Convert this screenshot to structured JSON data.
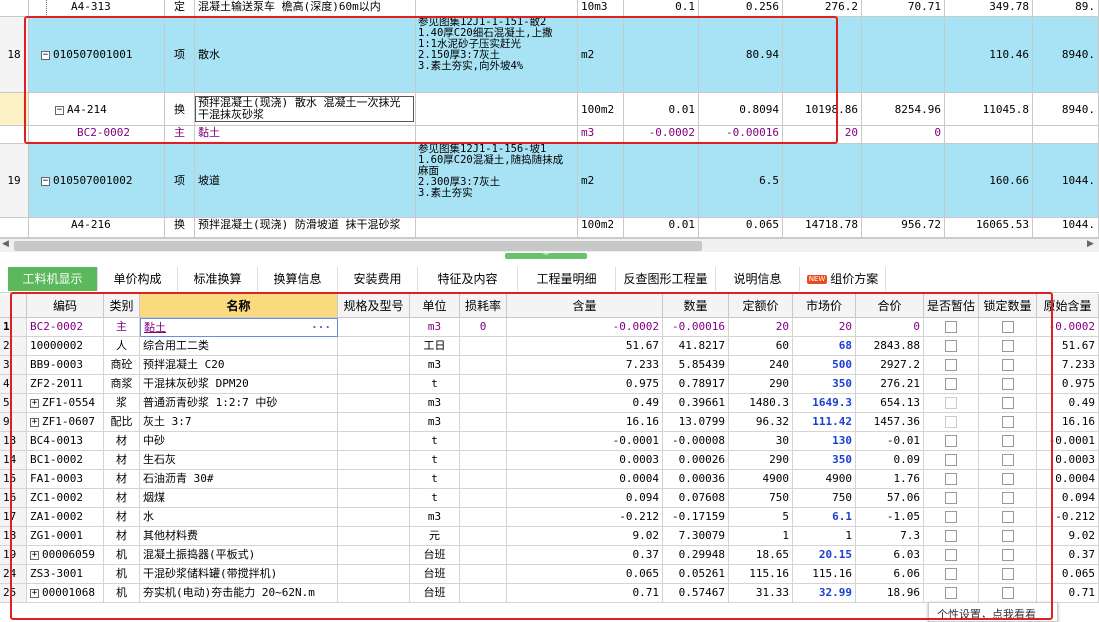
{
  "top_rows": [
    {
      "rownum": "",
      "code": "A4-313",
      "type": "定",
      "name": "混凝土输送泵车 檐高(深度)60m以内",
      "desc": "",
      "unit": "10m3",
      "c1": "0.1",
      "c2": "0.256",
      "c3": "276.2",
      "c4": "70.71",
      "c5": "349.78",
      "c6": "89."
    },
    {
      "rownum": "18",
      "code": "010507001001",
      "type": "项",
      "name": "散水",
      "desc": "参见图集12J1-1-151-散2\n1.40厚C20细石混凝土,上撒\n1:1水泥砂子压实赶光\n2.150厚3:7灰土\n3.素土夯实,向外坡4%",
      "unit": "m2",
      "c1": "",
      "c2": "80.94",
      "c3": "",
      "c4": "",
      "c5": "110.46",
      "c6": "8940."
    },
    {
      "rownum": "",
      "code": "A4-214",
      "type": "换",
      "name": "预拌混凝土(现浇) 散水 混凝土一次抹光 干混抹灰砂浆",
      "desc": "",
      "unit": "100m2",
      "c1": "0.01",
      "c2": "0.8094",
      "c3": "10198.86",
      "c4": "8254.96",
      "c5": "11045.8",
      "c6": "8940."
    },
    {
      "rownum": "",
      "code": "BC2-0002",
      "type": "主",
      "name": "黏土",
      "desc": "",
      "unit": "m3",
      "c1": "-0.0002",
      "c2": "-0.00016",
      "c3": "20",
      "c4": "0",
      "c5": "",
      "c6": ""
    },
    {
      "rownum": "19",
      "code": "010507001002",
      "type": "项",
      "name": "坡道",
      "desc": "参见图集12J1-1-156-坡1\n1.60厚C20混凝土,随捣随抹成\n麻面\n2.300厚3:7灰土\n3.素土夯实",
      "unit": "m2",
      "c1": "",
      "c2": "6.5",
      "c3": "",
      "c4": "",
      "c5": "160.66",
      "c6": "1044."
    },
    {
      "rownum": "",
      "code": "A4-216",
      "type": "换",
      "name": "预拌混凝土(现浇) 防滑坡道 抹干混砂浆",
      "desc": "",
      "unit": "100m2",
      "c1": "0.01",
      "c2": "0.065",
      "c3": "14718.78",
      "c4": "956.72",
      "c5": "16065.53",
      "c6": "1044."
    }
  ],
  "tabs": [
    "工料机显示",
    "单价构成",
    "标准换算",
    "换算信息",
    "安装费用",
    "特征及内容",
    "工程量明细",
    "反查图形工程量",
    "说明信息",
    "组价方案"
  ],
  "new_badge": "NEW",
  "headers": [
    "编码",
    "类别",
    "名称",
    "规格及型号",
    "单位",
    "损耗率",
    "含量",
    "数量",
    "定额价",
    "市场价",
    "合价",
    "是否暂估",
    "锁定数量",
    "原始含量"
  ],
  "rows": [
    {
      "no": "1",
      "code": "BC2-0002",
      "type": "主",
      "name": "黏土",
      "spec": "",
      "unit": "m3",
      "loss": "0",
      "content": "-0.0002",
      "qty": "-0.00016",
      "quota": "20",
      "market": "20",
      "total": "0",
      "orig": "-0.0002"
    },
    {
      "no": "2",
      "code": "10000002",
      "type": "人",
      "name": "综合用工二类",
      "spec": "",
      "unit": "工日",
      "loss": "",
      "content": "51.67",
      "qty": "41.8217",
      "quota": "60",
      "market": "68",
      "total": "2843.88",
      "orig": "51.67"
    },
    {
      "no": "3",
      "code": "BB9-0003",
      "type": "商砼",
      "name": "预拌混凝土 C20",
      "spec": "",
      "unit": "m3",
      "loss": "",
      "content": "7.233",
      "qty": "5.85439",
      "quota": "240",
      "market": "500",
      "total": "2927.2",
      "orig": "7.233"
    },
    {
      "no": "4",
      "code": "ZF2-2011",
      "type": "商浆",
      "name": "干混抹灰砂浆 DPM20",
      "spec": "",
      "unit": "t",
      "loss": "",
      "content": "0.975",
      "qty": "0.78917",
      "quota": "290",
      "market": "350",
      "total": "276.21",
      "orig": "0.975"
    },
    {
      "no": "5",
      "code": "ZF1-0554",
      "type": "浆",
      "name": "普通沥青砂浆 1:2:7 中砂",
      "spec": "",
      "unit": "m3",
      "loss": "",
      "content": "0.49",
      "qty": "0.39661",
      "quota": "1480.3",
      "market": "1649.3",
      "total": "654.13",
      "orig": "0.49"
    },
    {
      "no": "9",
      "code": "ZF1-0607",
      "type": "配比",
      "name": "灰土 3:7",
      "spec": "",
      "unit": "m3",
      "loss": "",
      "content": "16.16",
      "qty": "13.0799",
      "quota": "96.32",
      "market": "111.42",
      "total": "1457.36",
      "orig": "16.16"
    },
    {
      "no": "13",
      "code": "BC4-0013",
      "type": "材",
      "name": "中砂",
      "spec": "",
      "unit": "t",
      "loss": "",
      "content": "-0.0001",
      "qty": "-0.00008",
      "quota": "30",
      "market": "130",
      "total": "-0.01",
      "orig": "-0.0001"
    },
    {
      "no": "14",
      "code": "BC1-0002",
      "type": "材",
      "name": "生石灰",
      "spec": "",
      "unit": "t",
      "loss": "",
      "content": "0.0003",
      "qty": "0.00026",
      "quota": "290",
      "market": "350",
      "total": "0.09",
      "orig": "0.0003"
    },
    {
      "no": "15",
      "code": "FA1-0003",
      "type": "材",
      "name": "石油沥青 30#",
      "spec": "",
      "unit": "t",
      "loss": "",
      "content": "0.0004",
      "qty": "0.00036",
      "quota": "4900",
      "market": "4900",
      "total": "1.76",
      "orig": "0.0004"
    },
    {
      "no": "16",
      "code": "ZC1-0002",
      "type": "材",
      "name": "烟煤",
      "spec": "",
      "unit": "t",
      "loss": "",
      "content": "0.094",
      "qty": "0.07608",
      "quota": "750",
      "market": "750",
      "total": "57.06",
      "orig": "0.094"
    },
    {
      "no": "17",
      "code": "ZA1-0002",
      "type": "材",
      "name": "水",
      "spec": "",
      "unit": "m3",
      "loss": "",
      "content": "-0.212",
      "qty": "-0.17159",
      "quota": "5",
      "market": "6.1",
      "total": "-1.05",
      "orig": "-0.212"
    },
    {
      "no": "18",
      "code": "ZG1-0001",
      "type": "材",
      "name": "其他材料费",
      "spec": "",
      "unit": "元",
      "loss": "",
      "content": "9.02",
      "qty": "7.30079",
      "quota": "1",
      "market": "1",
      "total": "7.3",
      "orig": "9.02"
    },
    {
      "no": "19",
      "code": "00006059",
      "type": "机",
      "name": "混凝土振捣器(平板式)",
      "spec": "",
      "unit": "台班",
      "loss": "",
      "content": "0.37",
      "qty": "0.29948",
      "quota": "18.65",
      "market": "20.15",
      "total": "6.03",
      "orig": "0.37"
    },
    {
      "no": "24",
      "code": "ZS3-3001",
      "type": "机",
      "name": "干混砂浆储料罐(带搅拌机)",
      "spec": "",
      "unit": "台班",
      "loss": "",
      "content": "0.065",
      "qty": "0.05261",
      "quota": "115.16",
      "market": "115.16",
      "total": "6.06",
      "orig": "0.065"
    },
    {
      "no": "25",
      "code": "00001068",
      "type": "机",
      "name": "夯实机(电动)夯击能力 20~62N.m",
      "spec": "",
      "unit": "台班",
      "loss": "",
      "content": "0.71",
      "qty": "0.57467",
      "quota": "31.33",
      "market": "32.99",
      "total": "18.96",
      "orig": "0.71"
    }
  ],
  "tooltip": "个性设置，点我看看",
  "colors": {
    "item_row": "#a8e3f5",
    "selected_row": "#fdf1c6",
    "active_tab": "#5cb85c",
    "highlight_header": "#fbd97e",
    "annotation": "#e02020",
    "bold_price": "#1a3fd0"
  }
}
